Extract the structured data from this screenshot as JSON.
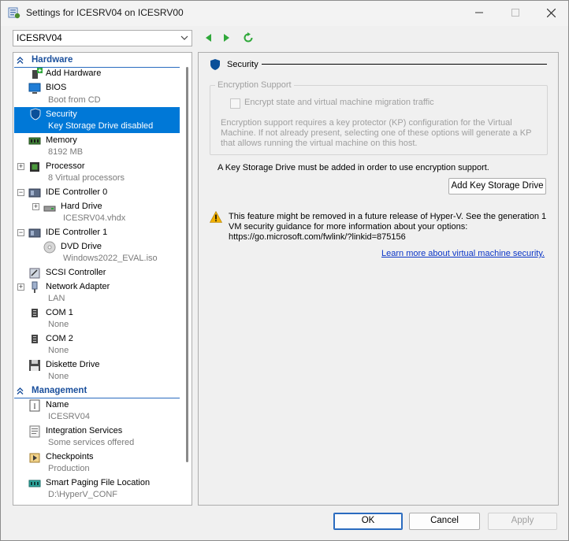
{
  "window": {
    "title": "Settings for ICESRV04 on ICESRV00",
    "minimize_icon": "minimize-icon",
    "maximize_icon": "maximize-icon",
    "close_icon": "close-icon"
  },
  "toolbar": {
    "vm_selected": "ICESRV04",
    "back_icon": "arrow-left-icon",
    "forward_icon": "arrow-right-icon",
    "refresh_icon": "refresh-icon"
  },
  "tree": {
    "hardware_label": "Hardware",
    "management_label": "Management",
    "hardware_items": [
      {
        "label": "Add Hardware",
        "sub": ""
      },
      {
        "label": "BIOS",
        "sub": "Boot from CD"
      },
      {
        "label": "Security",
        "sub": "Key Storage Drive disabled"
      },
      {
        "label": "Memory",
        "sub": "8192 MB"
      },
      {
        "label": "Processor",
        "sub": "8 Virtual processors"
      },
      {
        "label": "IDE Controller 0",
        "sub": ""
      },
      {
        "label": "Hard Drive",
        "sub": "ICESRV04.vhdx"
      },
      {
        "label": "IDE Controller 1",
        "sub": ""
      },
      {
        "label": "DVD Drive",
        "sub": "Windows2022_EVAL.iso"
      },
      {
        "label": "SCSI Controller",
        "sub": ""
      },
      {
        "label": "Network Adapter",
        "sub": "LAN"
      },
      {
        "label": "COM 1",
        "sub": "None"
      },
      {
        "label": "COM 2",
        "sub": "None"
      },
      {
        "label": "Diskette Drive",
        "sub": "None"
      }
    ],
    "management_items": [
      {
        "label": "Name",
        "sub": "ICESRV04"
      },
      {
        "label": "Integration Services",
        "sub": "Some services offered"
      },
      {
        "label": "Checkpoints",
        "sub": "Production"
      },
      {
        "label": "Smart Paging File Location",
        "sub": "D:\\HyperV_CONF"
      }
    ]
  },
  "security": {
    "title": "Security",
    "group_label": "Encryption Support",
    "checkbox_label": "Encrypt state and virtual machine migration traffic",
    "group_description": "Encryption support requires a key protector (KP) configuration for the Virtual Machine. If not already present, selecting one of these options will generate a KP that allows running the virtual machine on this host.",
    "ksd_note": "A Key Storage Drive must be added in order to use encryption support.",
    "add_ksd_button": "Add Key Storage Drive",
    "warning_text": "This feature might be removed in a future release of Hyper-V. See the generation 1 VM security guidance for more information about your options: https://go.microsoft.com/fwlink/?linkid=875156",
    "learn_more_link": "Learn more about virtual machine security."
  },
  "footer": {
    "ok_label": "OK",
    "cancel_label": "Cancel",
    "apply_label": "Apply"
  },
  "colors": {
    "selection": "#0078d7",
    "section_header": "#1a4f9c",
    "link": "#0b36c7",
    "warning": "#f2b100"
  }
}
